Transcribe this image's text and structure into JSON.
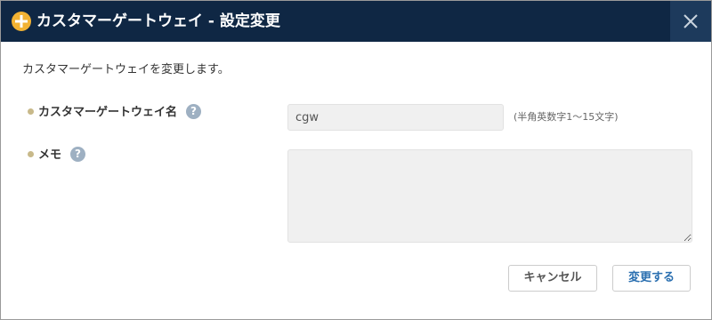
{
  "dialog": {
    "title": "カスタマーゲートウェイ - 設定変更",
    "description": "カスタマーゲートウェイを変更します。"
  },
  "fields": {
    "name": {
      "label": "カスタマーゲートウェイ名",
      "value": "cgw",
      "hint": "(半角英数字1〜15文字)"
    },
    "memo": {
      "label": "メモ",
      "value": ""
    }
  },
  "help_glyph": "?",
  "buttons": {
    "cancel": "キャンセル",
    "submit": "変更する"
  },
  "colors": {
    "titlebar": "#0f2744",
    "close_button": "#1d3a5c",
    "title_icon": "#f2b233",
    "help_icon": "#9eb0c2",
    "submit_text": "#2a6fb0"
  },
  "icons": {
    "title": "crosshair-gateway-icon",
    "close": "close-icon",
    "help": "help-icon",
    "bullet": "bullet-icon"
  }
}
